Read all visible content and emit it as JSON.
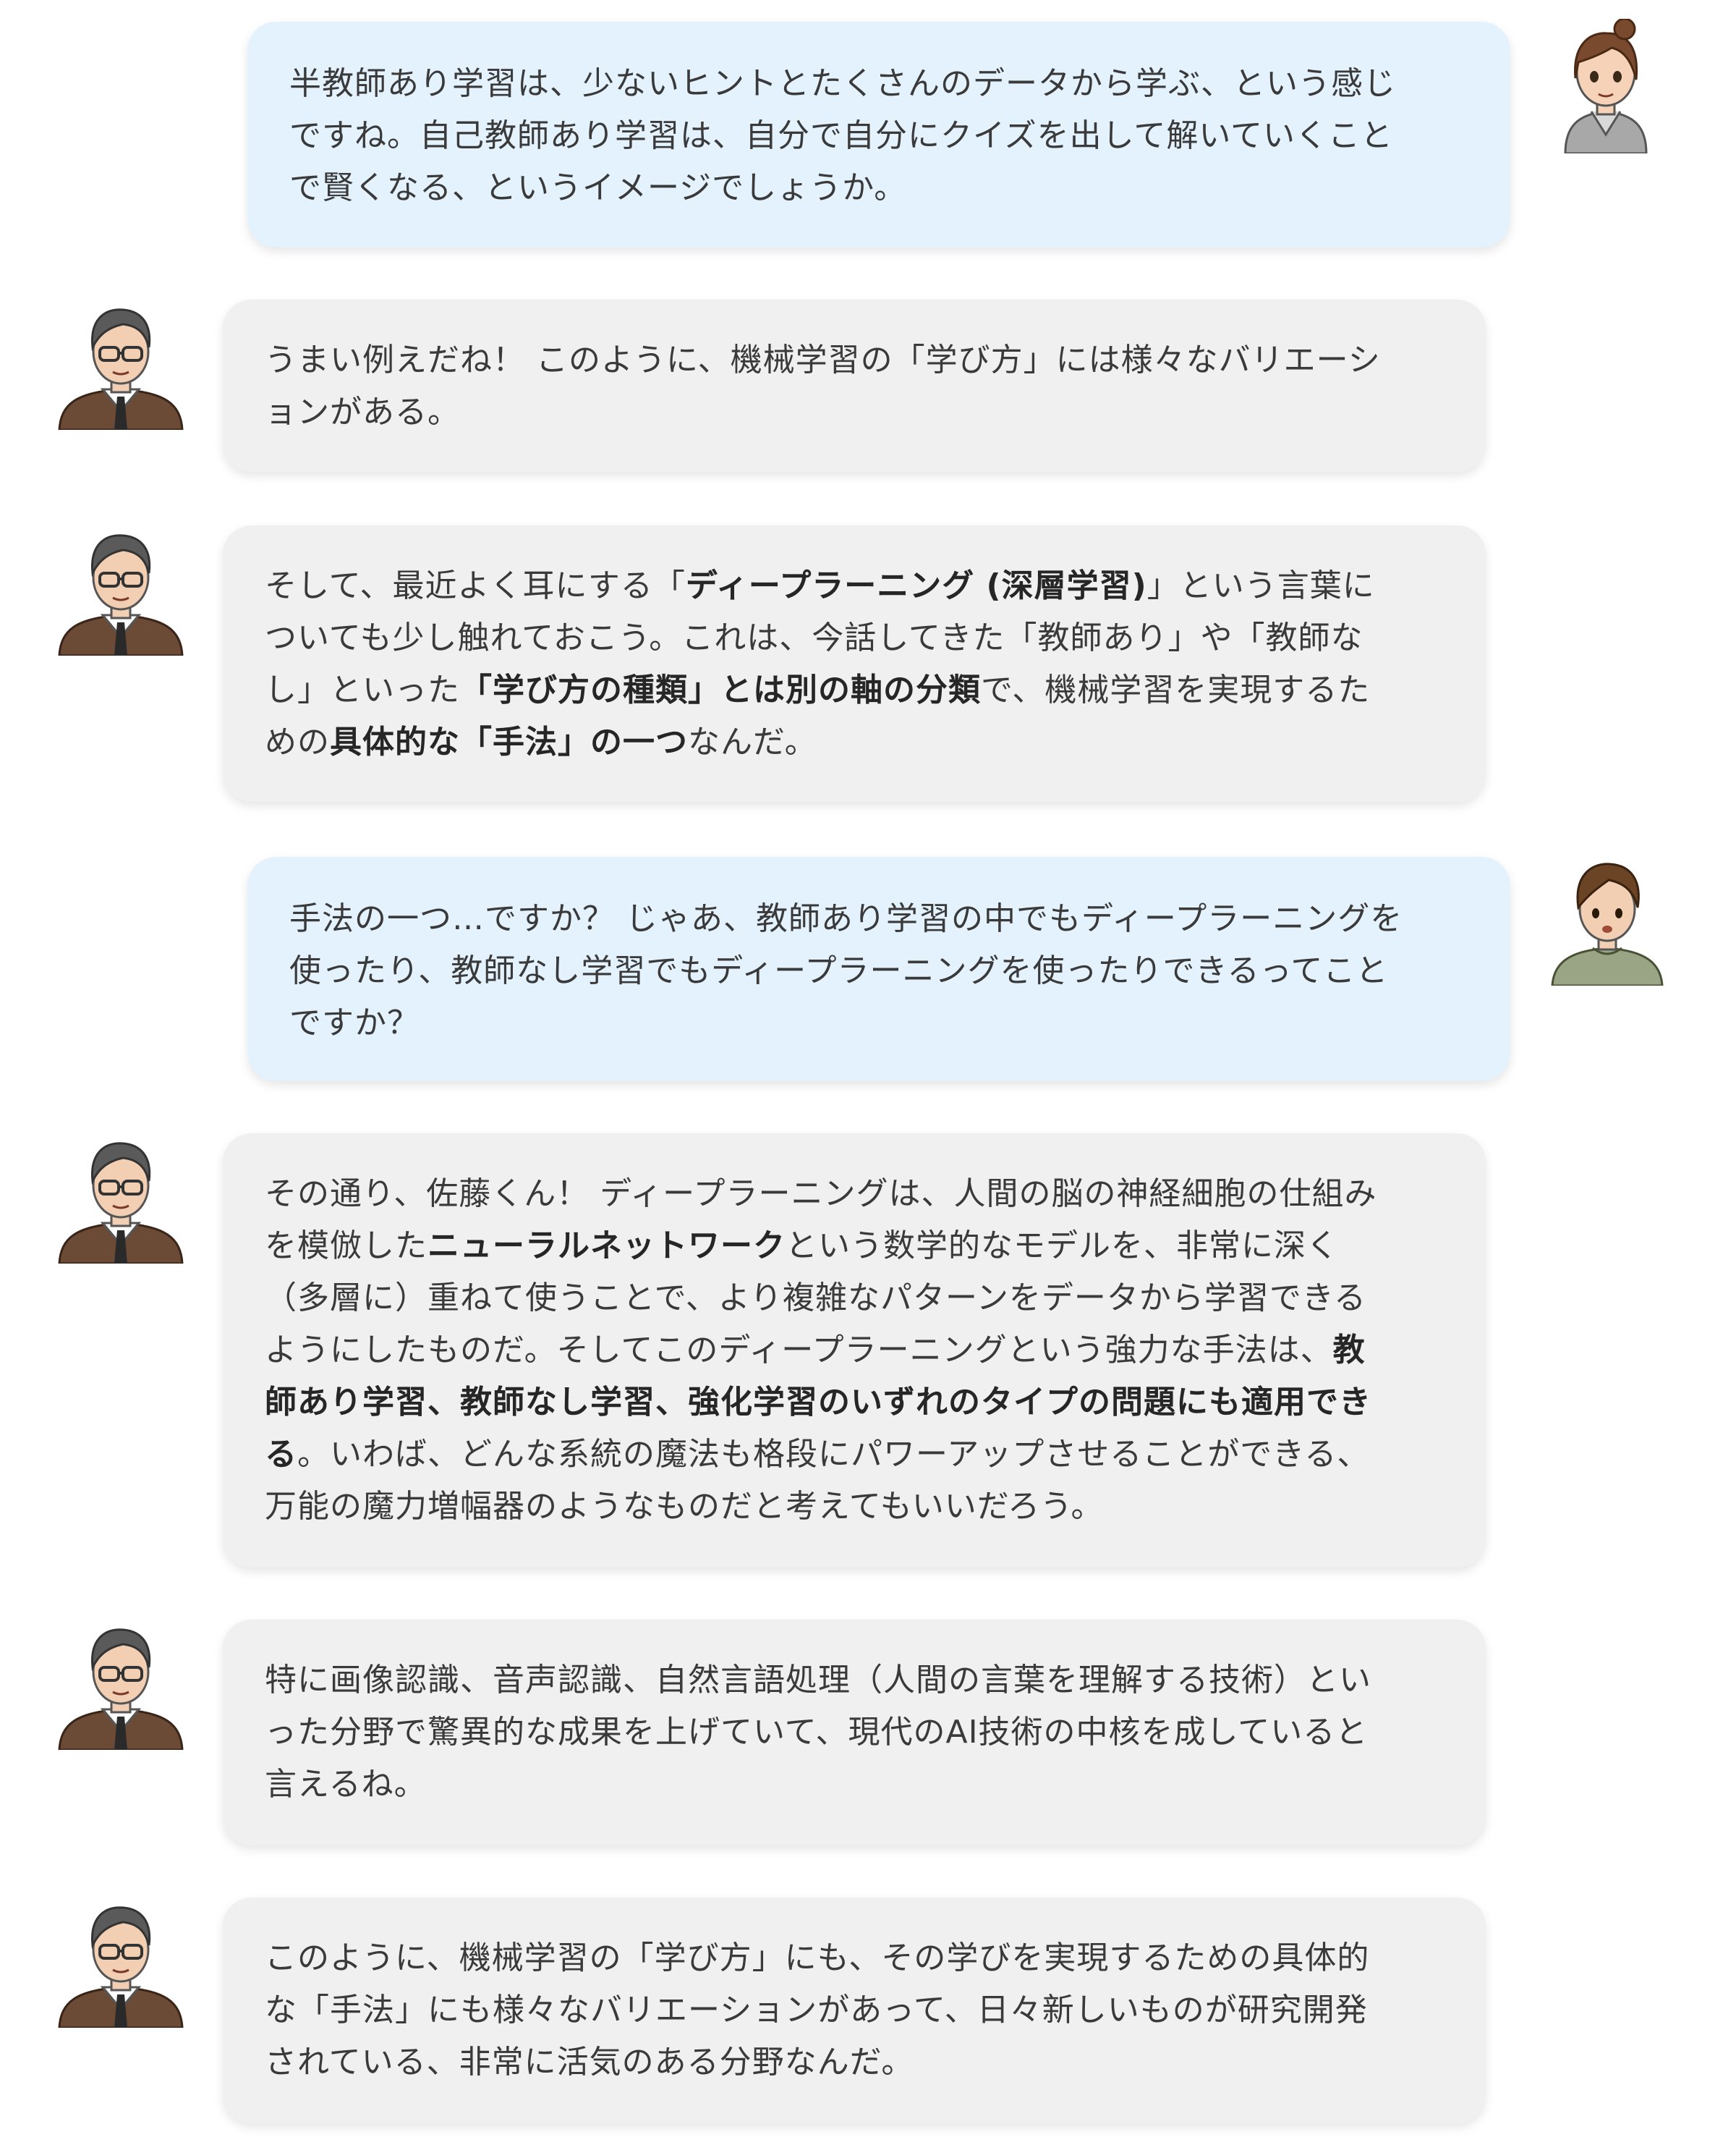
{
  "colors": {
    "student_bubble": "#e3f2fd",
    "teacher_bubble": "#f0f0f0",
    "text": "#3a3a3a"
  },
  "messages": [
    {
      "speaker": "student-girl",
      "lines": [
        [
          {
            "t": "半教師あり学習は、少ないヒントとたくさんのデータから学ぶ、という感じ"
          }
        ],
        [
          {
            "t": "ですね。自己教師あり学習は、自分で自分にクイズを出して解いていくこと"
          }
        ],
        [
          {
            "t": "で賢くなる、というイメージでしょうか。"
          }
        ]
      ]
    },
    {
      "speaker": "teacher",
      "lines": [
        [
          {
            "t": "うまい例えだね！ このように、機械学習の「学び方」には様々なバリエーシ"
          }
        ],
        [
          {
            "t": "ョンがある。"
          }
        ]
      ]
    },
    {
      "speaker": "teacher",
      "lines": [
        [
          {
            "t": "そして、最近よく耳にする「"
          },
          {
            "t": "ディープラーニング (深層学習)",
            "b": true
          },
          {
            "t": "」という言葉に"
          }
        ],
        [
          {
            "t": "ついても少し触れておこう。これは、今話してきた「教師あり」や「教師な"
          }
        ],
        [
          {
            "t": "し」といった"
          },
          {
            "t": "「学び方の種類」とは別の軸の分類",
            "b": true
          },
          {
            "t": "で、機械学習を実現するた"
          }
        ],
        [
          {
            "t": "めの"
          },
          {
            "t": "具体的な「手法」の一つ",
            "b": true
          },
          {
            "t": "なんだ。"
          }
        ]
      ]
    },
    {
      "speaker": "student-boy",
      "lines": [
        [
          {
            "t": "手法の一つ…ですか？ じゃあ、教師あり学習の中でもディープラーニングを"
          }
        ],
        [
          {
            "t": "使ったり、教師なし学習でもディープラーニングを使ったりできるってこと"
          }
        ],
        [
          {
            "t": "ですか？"
          }
        ]
      ]
    },
    {
      "speaker": "teacher",
      "lines": [
        [
          {
            "t": "その通り、佐藤くん！ ディープラーニングは、人間の脳の神経細胞の仕組み"
          }
        ],
        [
          {
            "t": "を模倣した"
          },
          {
            "t": "ニューラルネットワーク",
            "b": true
          },
          {
            "t": "という数学的なモデルを、非常に深く"
          }
        ],
        [
          {
            "t": "（多層に）重ねて使うことで、より複雑なパターンをデータから学習できる"
          }
        ],
        [
          {
            "t": "ようにしたものだ。そしてこのディープラーニングという強力な手法は、"
          },
          {
            "t": "教",
            "b": true
          }
        ],
        [
          {
            "t": "師あり学習、教師なし学習、強化学習のいずれのタイプの問題にも適用でき",
            "b": true
          }
        ],
        [
          {
            "t": "る",
            "b": true
          },
          {
            "t": "。いわば、どんな系統の魔法も格段にパワーアップさせることができる、"
          }
        ],
        [
          {
            "t": "万能の魔力増幅器のようなものだと考えてもいいだろう。"
          }
        ]
      ]
    },
    {
      "speaker": "teacher",
      "lines": [
        [
          {
            "t": "特に画像認識、音声認識、自然言語処理（人間の言葉を理解する技術）とい"
          }
        ],
        [
          {
            "t": "った分野で驚異的な成果を上げていて、現代のAI技術の中核を成していると"
          }
        ],
        [
          {
            "t": "言えるね。"
          }
        ]
      ]
    },
    {
      "speaker": "teacher",
      "lines": [
        [
          {
            "t": "このように、機械学習の「学び方」にも、その学びを実現するための具体的"
          }
        ],
        [
          {
            "t": "な「手法」にも様々なバリエーションがあって、日々新しいものが研究開発"
          }
        ],
        [
          {
            "t": "されている、非常に活気のある分野なんだ。"
          }
        ]
      ]
    }
  ]
}
